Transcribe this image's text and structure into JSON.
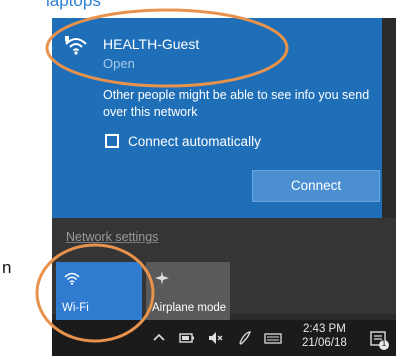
{
  "captions": {
    "top": "laptops",
    "side": "n"
  },
  "network": {
    "ssid": "HEALTH-Guest",
    "status": "Open",
    "warning": "Other people might be able to see info you send over this network",
    "auto_connect_label": "Connect automatically",
    "auto_connect_checked": false,
    "connect_label": "Connect"
  },
  "settings": {
    "link_label": "Network settings"
  },
  "quick_actions": [
    {
      "label": "Wi-Fi",
      "icon": "wifi-icon",
      "active": true
    },
    {
      "label": "Airplane mode",
      "icon": "airplane-icon",
      "active": false
    }
  ],
  "taskbar": {
    "time": "2:43 PM",
    "date": "21/06/18",
    "notification_count": "1",
    "icons": [
      "chevron-up-icon",
      "battery-icon",
      "volume-muted-icon",
      "pen-icon",
      "keyboard-icon",
      "notification-icon"
    ]
  },
  "colors": {
    "accent_blue": "#1f6fb8",
    "annotation_orange": "#e8924c",
    "caption_blue": "#2d7fd3"
  }
}
